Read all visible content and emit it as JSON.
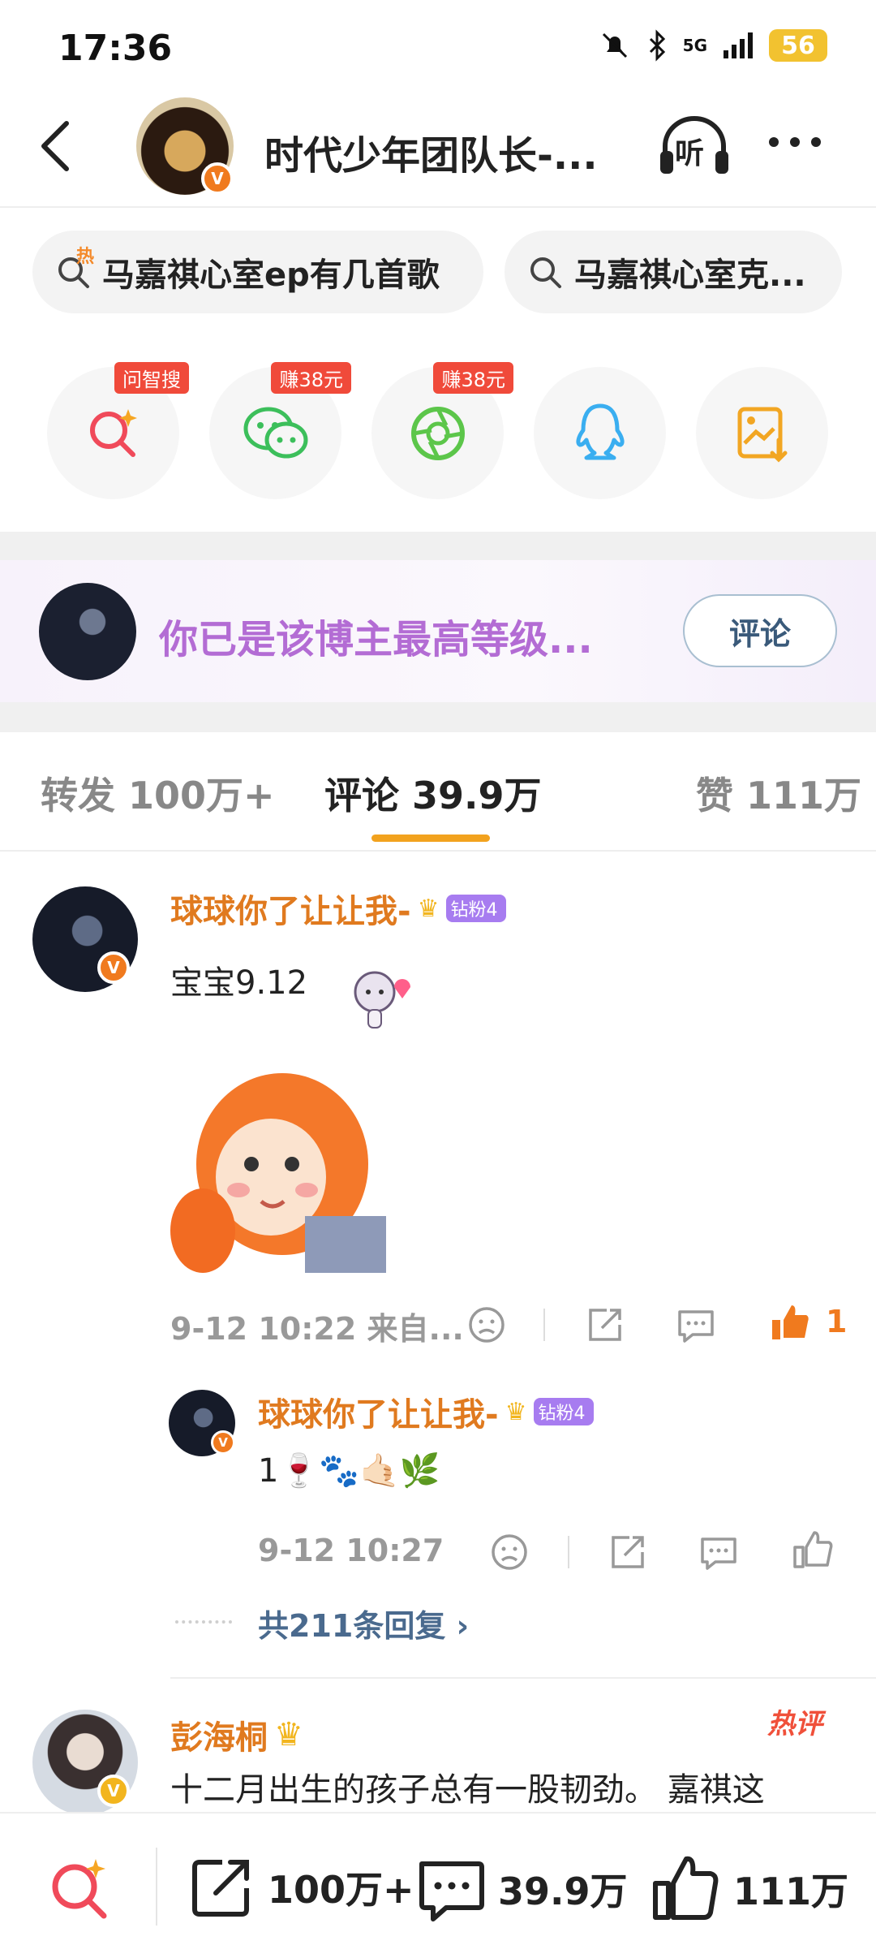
{
  "status": {
    "time": "17:36",
    "network": "5G",
    "battery": "56"
  },
  "nav": {
    "title": "时代少年团队长-...",
    "listen_label": "听"
  },
  "search_chips": [
    {
      "text": "马嘉祺心室ep有几首歌",
      "hot_label": "热"
    },
    {
      "text": "马嘉祺心室克..."
    }
  ],
  "share": {
    "ai_search_tag": "问智搜",
    "wechat_tag": "赚38元",
    "moments_tag": "赚38元"
  },
  "fan_banner": {
    "text": "你已是该博主最高等级...",
    "button": "评论"
  },
  "tabs": {
    "repost": "转发 100万+",
    "comments": "评论 39.9万",
    "likes": "赞 111万"
  },
  "comment1": {
    "user": "球球你了让让我-",
    "fan_level": "钻粉4",
    "text": "宝宝9.12",
    "time": "9-12 10:22  来自...",
    "likes": "1"
  },
  "reply1": {
    "user": "球球你了让让我-",
    "fan_level": "钻粉4",
    "text": "1🍷🐾🤙🏻🌿",
    "time": "9-12 10:27",
    "more_replies": "共211条回复 ›"
  },
  "comment2": {
    "user": "彭海桐",
    "hot_label": "热评",
    "text": "十二月出生的孩子总有一股韧劲。 嘉祺这"
  },
  "bottom_bar": {
    "reposts": "100万+",
    "comments": "39.9万",
    "likes": "111万"
  },
  "colors": {
    "accent_orange": "#e07a1f",
    "tab_underline": "#f2a21e",
    "fan_text": "#b36cd4",
    "link_blue": "#4a6a8e",
    "tag_red": "#f04a3a"
  }
}
